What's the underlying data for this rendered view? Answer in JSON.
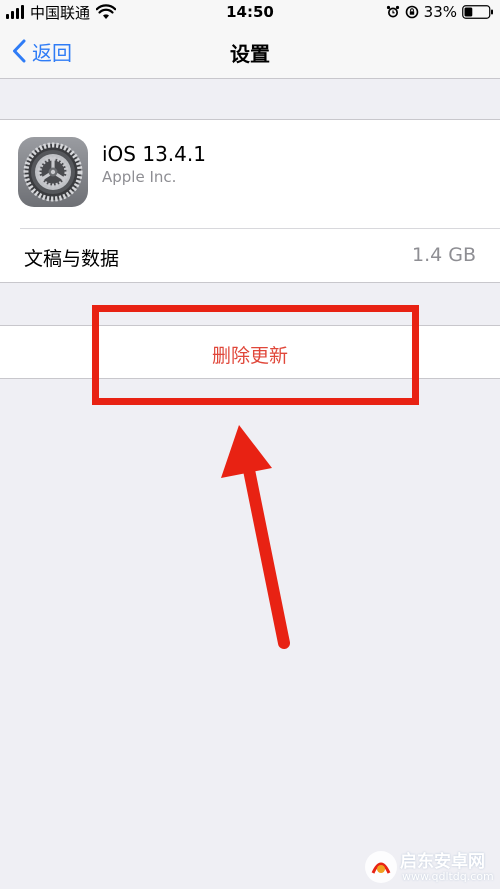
{
  "status_bar": {
    "carrier": "中国联通",
    "time": "14:50",
    "battery": "33%",
    "battery_level": 0.33
  },
  "nav": {
    "back_label": "返回",
    "title": "设置"
  },
  "app": {
    "name": "iOS 13.4.1",
    "vendor": "Apple Inc.",
    "icon": "settings-gear-icon"
  },
  "storage": {
    "label": "文稿与数据",
    "value": "1.4 GB"
  },
  "actions": {
    "delete_label": "删除更新"
  },
  "annotation": {
    "color": "#e82213"
  },
  "watermark": {
    "text": "启东安卓网",
    "url": "www.qdltdq.com"
  },
  "colors": {
    "accent": "#2f7cf6",
    "destructive": "#e0473a",
    "background": "#efeff4"
  }
}
